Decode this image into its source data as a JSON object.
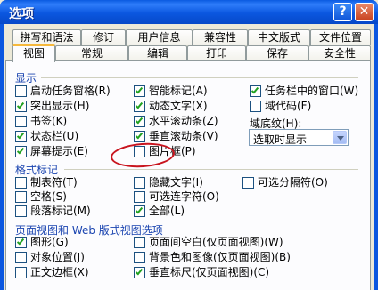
{
  "window": {
    "title": "选项",
    "help_label": "?",
    "close_label": "✕"
  },
  "tabs_row1": [
    "拼写和语法",
    "修订",
    "用户信息",
    "兼容性",
    "中文版式",
    "文件位置"
  ],
  "tabs_row2": [
    "视图",
    "常规",
    "编辑",
    "打印",
    "保存",
    "安全性"
  ],
  "active_tab": "视图",
  "display": {
    "title": "显示",
    "col1": [
      {
        "label": "启动任务窗格(R)",
        "checked": false
      },
      {
        "label": "突出显示(H)",
        "checked": true
      },
      {
        "label": "书签(K)",
        "checked": false
      },
      {
        "label": "状态栏(U)",
        "checked": true
      },
      {
        "label": "屏幕提示(E)",
        "checked": true
      }
    ],
    "col2": [
      {
        "label": "智能标记(A)",
        "checked": true
      },
      {
        "label": "动态文字(X)",
        "checked": true
      },
      {
        "label": "水平滚动条(Z)",
        "checked": true
      },
      {
        "label": "垂直滚动条(V)",
        "checked": true
      },
      {
        "label": "图片框(P)",
        "checked": false
      }
    ],
    "col3": [
      {
        "label": "任务栏中的窗口(W)",
        "checked": true
      },
      {
        "label": "域代码(F)",
        "checked": false
      }
    ],
    "shading_label": "域底纹(H):",
    "shading_value": "选取时显示"
  },
  "format_marks": {
    "title": "格式标记",
    "col1": [
      {
        "label": "制表符(T)",
        "checked": false
      },
      {
        "label": "空格(S)",
        "checked": false
      },
      {
        "label": "段落标记(M)",
        "checked": false
      }
    ],
    "col2": [
      {
        "label": "隐藏文字(I)",
        "checked": false
      },
      {
        "label": "可选连字符(O)",
        "checked": false
      },
      {
        "label": "全部(L)",
        "checked": true
      }
    ],
    "col3": [
      {
        "label": "可选分隔符(O)",
        "checked": false
      }
    ]
  },
  "page_view": {
    "title": "页面视图和 Web 版式视图选项",
    "col1": [
      {
        "label": "图形(G)",
        "checked": true
      },
      {
        "label": "对象位置(J)",
        "checked": false
      },
      {
        "label": "正文边框(X)",
        "checked": false
      }
    ],
    "col2": [
      {
        "label": "页面间空白(仅页面视图)(W)",
        "checked": false
      },
      {
        "label": "背景色和图像(仅页面视图)(B)",
        "checked": false
      },
      {
        "label": "垂直标尺(仅页面视图)(C)",
        "checked": true
      }
    ]
  },
  "colors": {
    "title_bar": "#0b57e0",
    "group_label": "#1a44b0",
    "check": "#21a121",
    "annotation": "#c8141e",
    "tab_highlight": "#f6b83b"
  }
}
